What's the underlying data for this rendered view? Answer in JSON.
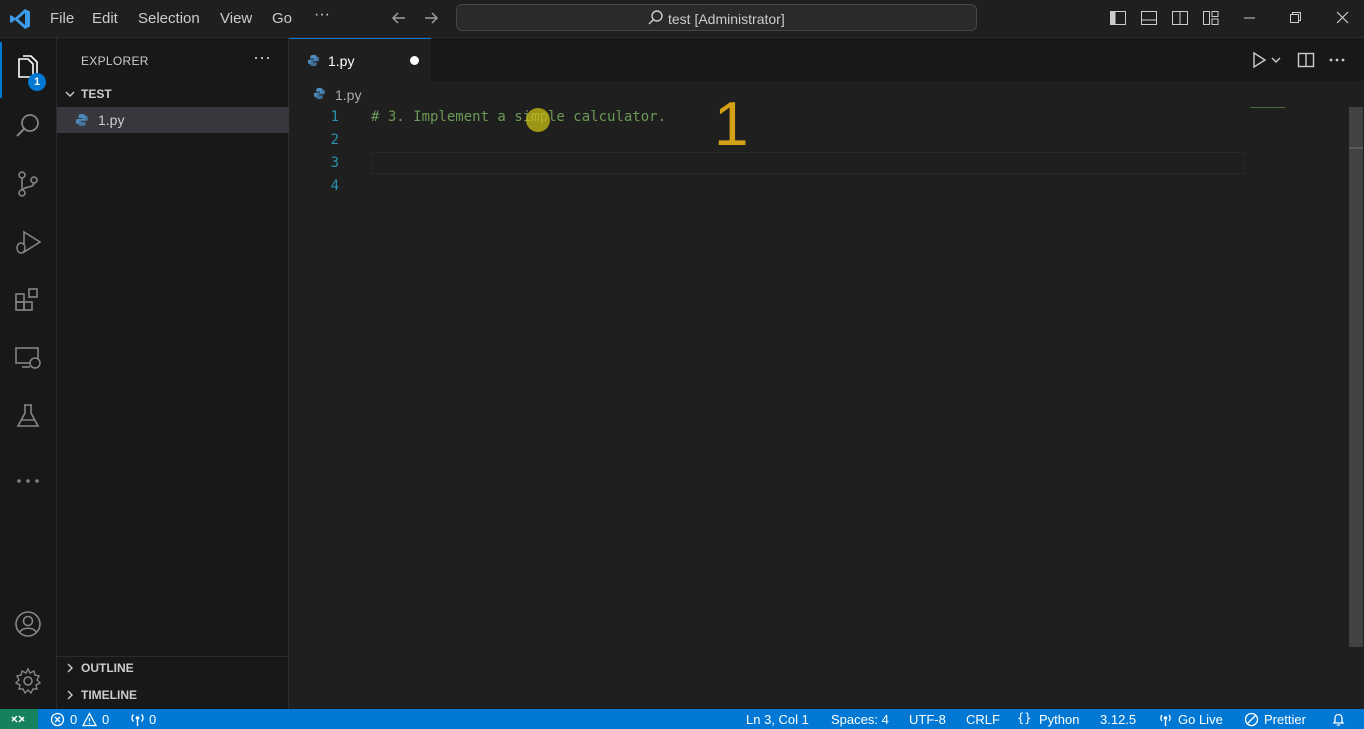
{
  "titlebar": {
    "menu": [
      "File",
      "Edit",
      "Selection",
      "View",
      "Go"
    ],
    "more": "···",
    "search_text": "test [Administrator]"
  },
  "activity": {
    "explorer_badge": "1"
  },
  "sidebar": {
    "title": "EXPLORER",
    "more": "···",
    "folder": "TEST",
    "file": "1.py",
    "outline": "OUTLINE",
    "timeline": "TIMELINE"
  },
  "editor": {
    "tab_label": "1.py",
    "breadcrumb": "1.py",
    "line_numbers": [
      "1",
      "2",
      "3",
      "4"
    ],
    "lines": [
      "# 3. Implement a simple calculator.",
      "",
      "",
      ""
    ],
    "annotation": "1"
  },
  "statusbar": {
    "errors": "0",
    "warnings": "0",
    "ports": "0",
    "position": "Ln 3, Col 1",
    "spaces": "Spaces: 4",
    "encoding": "UTF-8",
    "eol": "CRLF",
    "language": "Python",
    "version": "3.12.5",
    "go_live": "Go Live",
    "prettier": "Prettier"
  },
  "colors": {
    "accent": "#0078d4",
    "remote": "#16825d",
    "comment": "#6a9955",
    "line_number": "#2b91af"
  }
}
